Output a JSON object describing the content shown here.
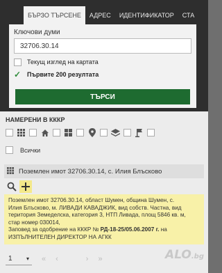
{
  "tabs": [
    "БЪРЗО ТЪРСЕНЕ",
    "АДРЕС",
    "ИДЕНТИФИКАТОР",
    "СТА"
  ],
  "search": {
    "keywords_label": "Ключови думи",
    "keywords_value": "32706.30.14",
    "current_view_label": "Текущ изглед на картата",
    "first200_label": "Първите 200 резултата",
    "button_label": "ТЪРСИ"
  },
  "results": {
    "title": "НАМЕРЕНИ В КККР",
    "all_label": "Всички",
    "item_title": "Поземлен имот 32706.30.14, с. Илия Блъсково",
    "desc_lines": [
      "Поземлен имот 32706.30.14, област Шумен, община Шумен, с.",
      "Илия Блъсково, м. ЛИВАДИ КАВАДЖИК, вид собств. Частна, вид",
      "територия Земеделска, категория 3, НТП Ливада, площ 5846 кв. м,",
      "стар номер 030014,"
    ],
    "order_prefix": "Заповед за одобрение на КККР № ",
    "order_number": "РД-18-25/05.06.2007 г.",
    "order_suffix": " на",
    "order_line2": "ИЗПЪЛНИТЕЛЕН ДИРЕКТОР НА АГКК"
  },
  "pager": {
    "page": "1",
    "dropdown": "▾",
    "first": "«",
    "prev": "‹",
    "next": "›",
    "last": "»"
  },
  "watermark": {
    "main": "ALO",
    "suffix": ".bg"
  },
  "colors": {
    "panel": "#2e2e2e",
    "search_button": "#1e6b30",
    "description_bg": "#f8f1a8",
    "check": "#2e8b3a"
  }
}
